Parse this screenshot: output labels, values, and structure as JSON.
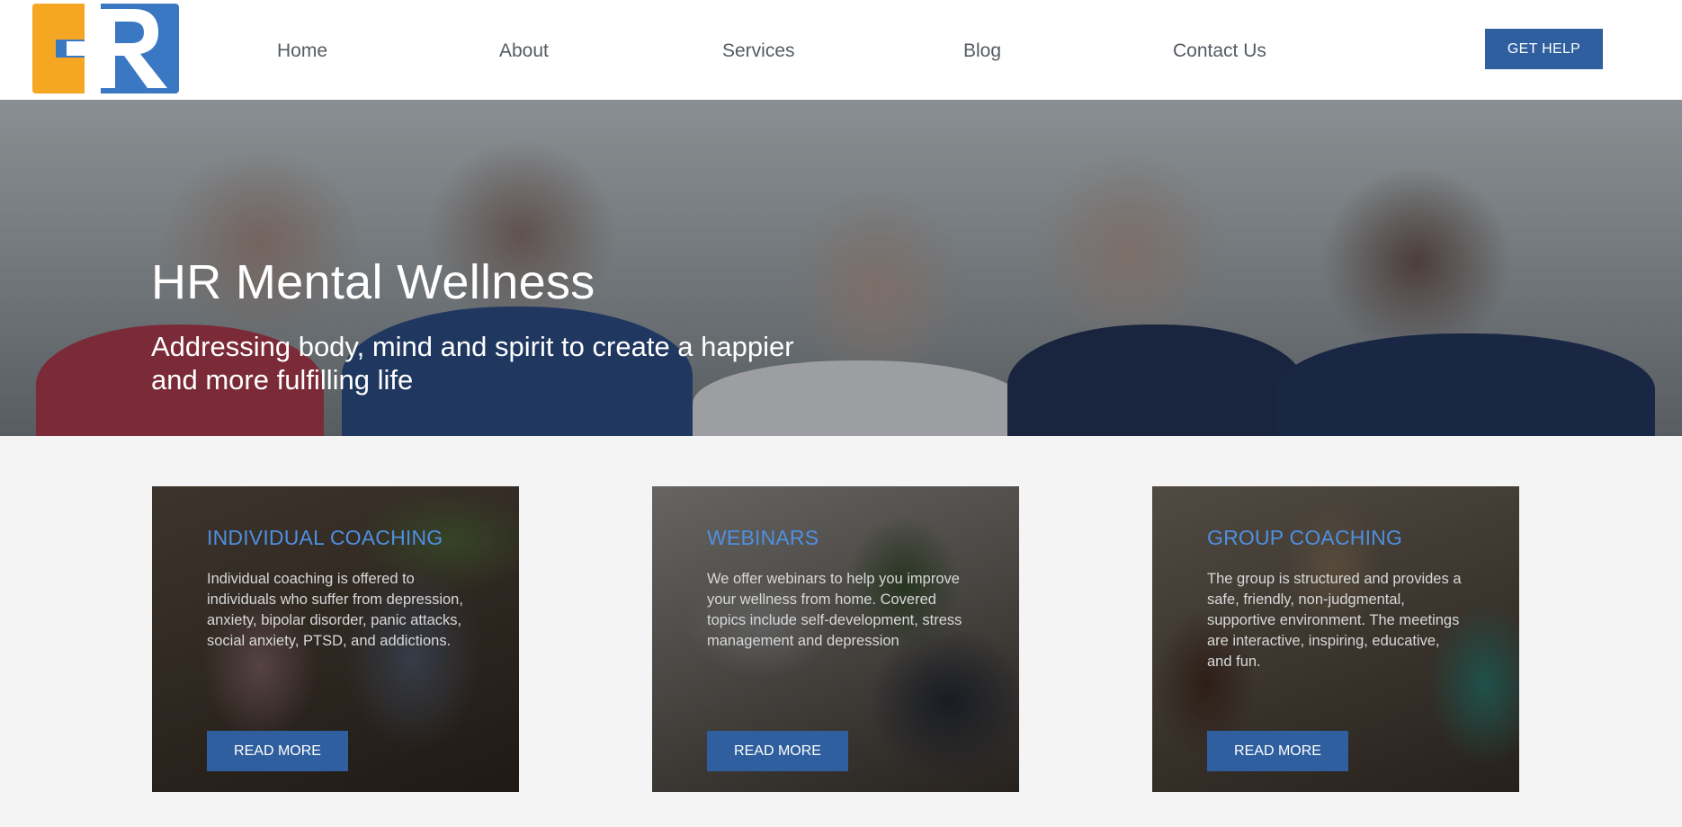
{
  "brand": {
    "logo_letters": "HR",
    "colors": {
      "orange": "#f5a623",
      "blue": "#2f5f9e",
      "light_blue": "#4a90d9"
    }
  },
  "nav": {
    "items": [
      {
        "label": "Home"
      },
      {
        "label": "About"
      },
      {
        "label": "Services"
      },
      {
        "label": "Blog"
      },
      {
        "label": "Contact Us"
      }
    ],
    "cta_label": "GET HELP"
  },
  "hero": {
    "title": "HR Mental Wellness",
    "subtitle": "Addressing body, mind and spirit to create a happier and more fulfilling life"
  },
  "cards": [
    {
      "title": "INDIVIDUAL COACHING",
      "text": "Individual coaching is offered to individuals who suffer from depression, anxiety, bipolar disorder, panic attacks, social anxiety, PTSD, and addictions.",
      "button": "READ MORE"
    },
    {
      "title": "WEBINARS",
      "text": "We offer webinars to help you improve your wellness from home. Covered topics include self-development, stress management and depression",
      "button": "READ MORE"
    },
    {
      "title": "GROUP COACHING",
      "text": "The group is structured and provides a safe, friendly, non-judgmental, supportive environment. The meetings are interactive, inspiring, educative, and fun.",
      "button": "READ MORE"
    }
  ]
}
